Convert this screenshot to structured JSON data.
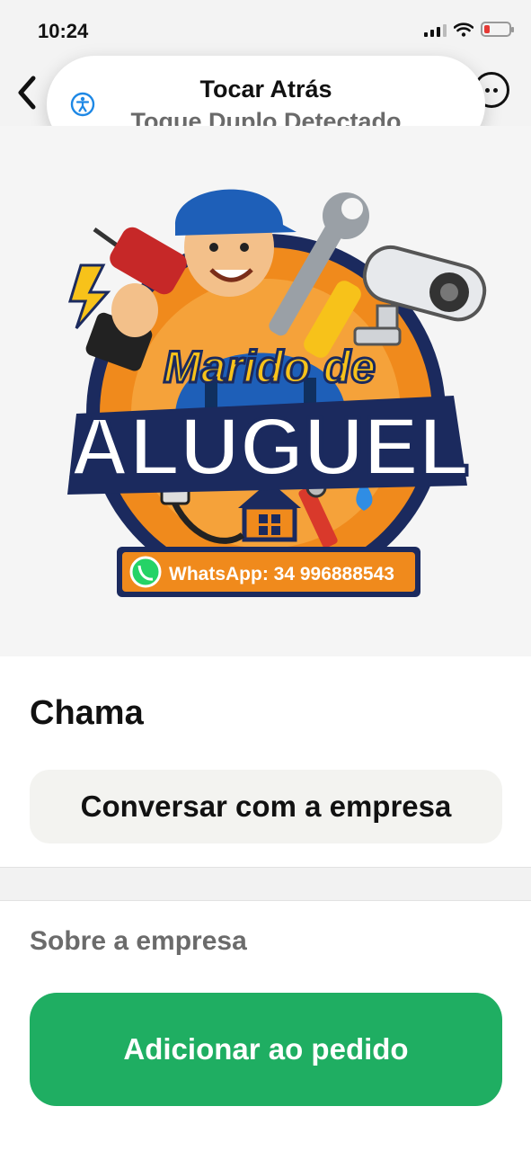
{
  "status_bar": {
    "time": "10:24",
    "battery_color": "#e53935"
  },
  "nav": {
    "back_icon": "chevron-left-icon",
    "more_icon": "ellipsis-circle-icon",
    "cart_icon": "cart-icon"
  },
  "toast": {
    "icon": "accessibility-icon",
    "title": "Tocar Atrás",
    "subtitle": "Toque Duplo Detectado",
    "icon_color": "#1e88e5"
  },
  "hero": {
    "logo_line1": "Marido de",
    "logo_line2": "ALUGUEL",
    "whatsapp": "WhatsApp: 34 996888543",
    "colors": {
      "navy": "#1b2a5e",
      "orange": "#f08a1c",
      "yellow": "#f7c21a",
      "blue": "#1e5fb8"
    }
  },
  "store": {
    "name": "Chama",
    "chat_button": "Conversar com a empresa"
  },
  "about": {
    "title": "Sobre a empresa"
  },
  "cta": {
    "label": "Adicionar ao pedido",
    "color": "#1fae62"
  }
}
